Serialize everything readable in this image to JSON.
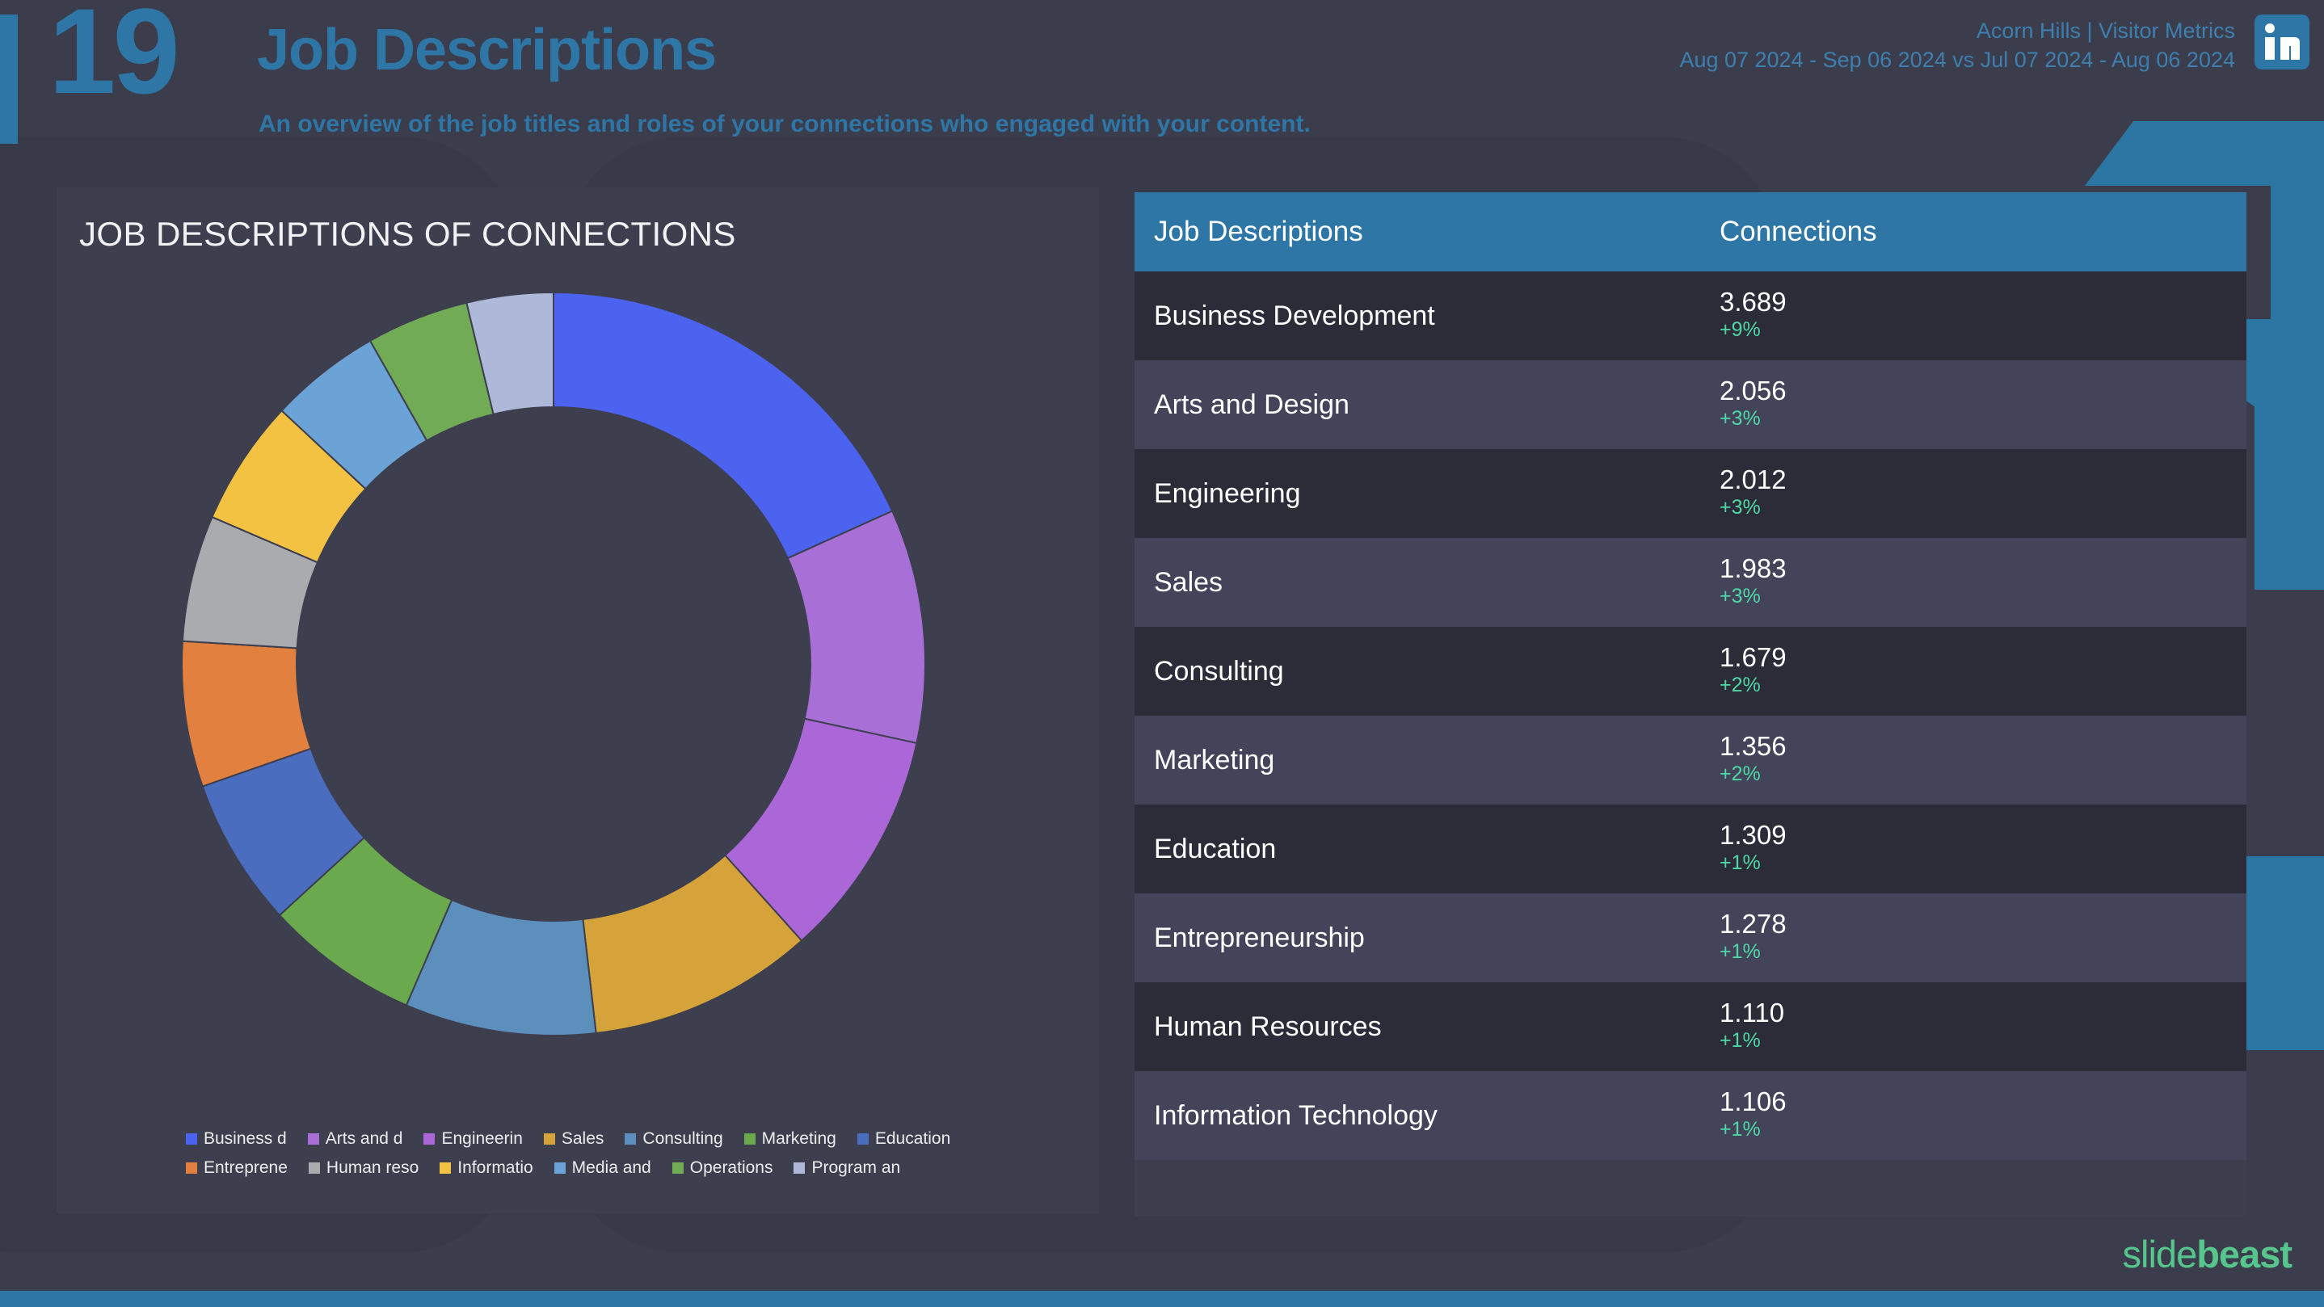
{
  "header": {
    "slide_number": "19",
    "title": "Job Descriptions",
    "subtitle": "An overview of the job titles and roles of your connections who engaged with your content.",
    "account_line": "Acorn Hills | Visitor Metrics",
    "date_range_line": "Aug 07 2024 - Sep 06 2024 vs Jul 07 2024 - Aug 06 2024",
    "network_icon": "linkedin-icon",
    "accent_color": "#2e76a6"
  },
  "chart_card": {
    "title": "JOB DESCRIPTIONS OF CONNECTIONS"
  },
  "table": {
    "columns": [
      "Job Descriptions",
      "Connections"
    ],
    "rows": [
      {
        "name": "Business Development",
        "value": "3.689",
        "change": "+9%"
      },
      {
        "name": "Arts and Design",
        "value": "2.056",
        "change": "+3%"
      },
      {
        "name": "Engineering",
        "value": "2.012",
        "change": "+3%"
      },
      {
        "name": "Sales",
        "value": "1.983",
        "change": "+3%"
      },
      {
        "name": "Consulting",
        "value": "1.679",
        "change": "+2%"
      },
      {
        "name": "Marketing",
        "value": "1.356",
        "change": "+2%"
      },
      {
        "name": "Education",
        "value": "1.309",
        "change": "+1%"
      },
      {
        "name": "Entrepreneurship",
        "value": "1.278",
        "change": "+1%"
      },
      {
        "name": "Human Resources",
        "value": "1.110",
        "change": "+1%"
      },
      {
        "name": "Information Technology",
        "value": "1.106",
        "change": "+1%"
      }
    ],
    "header_bg": "#2e76a6",
    "positive_color": "#4fd8a5"
  },
  "legend": {
    "rows": [
      [
        {
          "label": "Business d",
          "color": "#4c63f0"
        },
        {
          "label": "Arts and d",
          "color": "#a86fd6"
        },
        {
          "label": "Engineerin",
          "color": "#ab67d8"
        },
        {
          "label": "Sales",
          "color": "#d5a33a"
        },
        {
          "label": "Consulting",
          "color": "#5d8fbd"
        },
        {
          "label": "Marketing",
          "color": "#6ba council"
        },
        {
          "label": "Education",
          "color": "#4a6dc0"
        }
      ],
      [
        {
          "label": "Entreprene",
          "color": "#e2803f"
        },
        {
          "label": "Human reso",
          "color": "#a9abaf"
        },
        {
          "label": "Informatio",
          "color": "#f4c243"
        },
        {
          "label": "Media and",
          "color": "#6ba3d6"
        },
        {
          "label": "Operations",
          "color": "#72ab56"
        },
        {
          "label": "Program an",
          "color": "#aeb9da"
        }
      ]
    ]
  },
  "chart_data": {
    "type": "pie",
    "title": "JOB DESCRIPTIONS OF CONNECTIONS",
    "subtype": "donut",
    "legend_position": "bottom",
    "value_label": "Connections",
    "categories": [
      "Business Development",
      "Arts and Design",
      "Engineering",
      "Sales",
      "Consulting",
      "Marketing",
      "Education",
      "Entrepreneurship",
      "Human Resources",
      "Information Technology",
      "Media and Communication",
      "Operations",
      "Program and Project Management"
    ],
    "values": [
      3689,
      2056,
      2012,
      1983,
      1679,
      1356,
      1309,
      1278,
      1110,
      1106,
      980,
      900,
      760
    ],
    "colors": [
      "#4c63f0",
      "#a86fd6",
      "#ab67d8",
      "#d5a33a",
      "#5d8fbd",
      "#6ba94e",
      "#4a6dc0",
      "#e2803f",
      "#a9abaf",
      "#f4c243",
      "#6ba3d6",
      "#72ab56",
      "#aeb9da"
    ],
    "changes_pct": [
      9,
      3,
      3,
      3,
      2,
      2,
      1,
      1,
      1,
      1,
      null,
      null,
      null
    ]
  },
  "footer": {
    "logo_part1": "slide",
    "logo_part2": "beast",
    "logo_color": "#56c68c"
  }
}
